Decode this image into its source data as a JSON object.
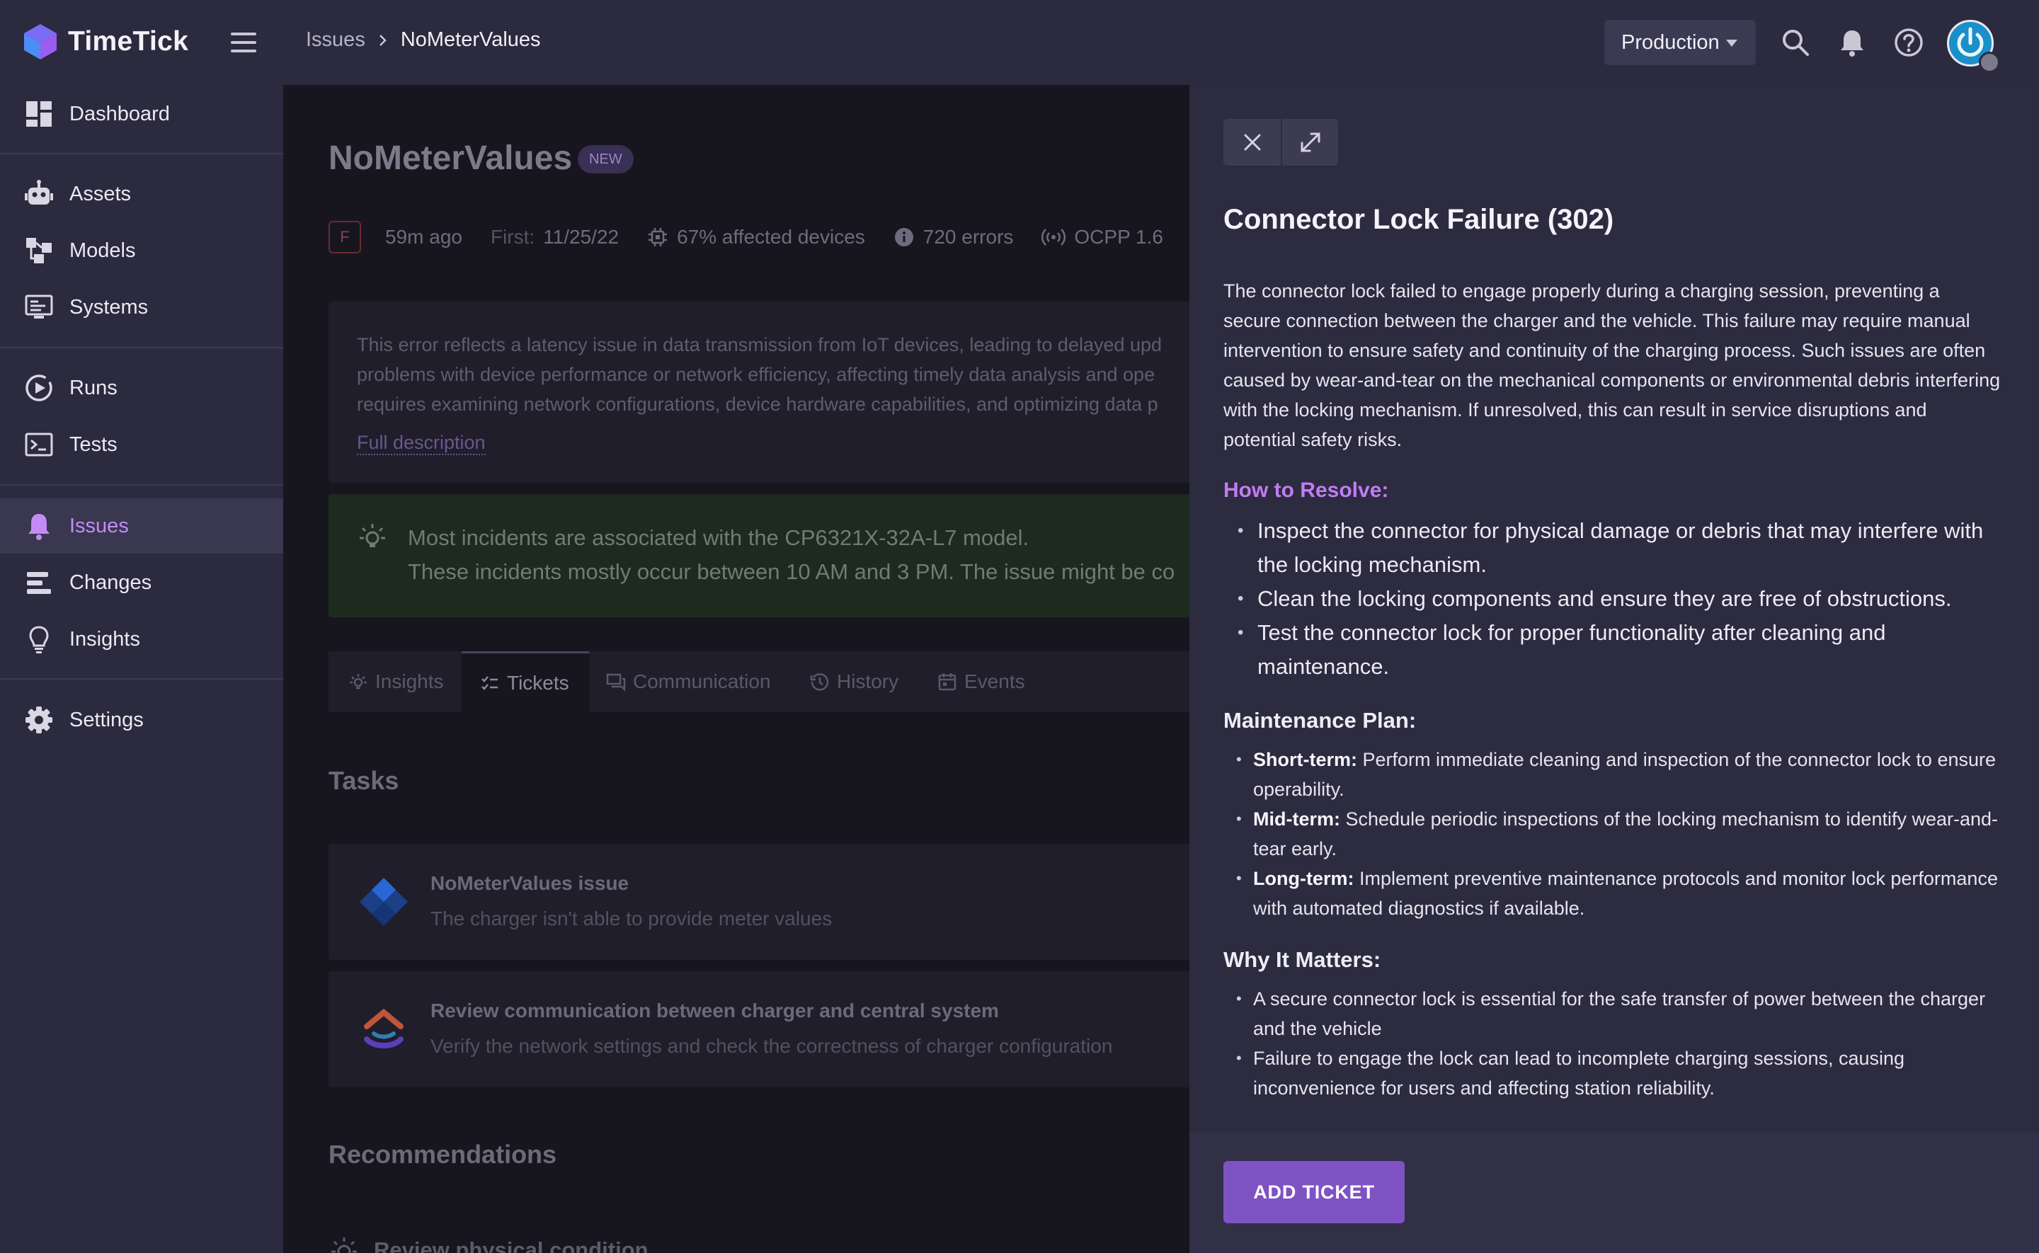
{
  "app": {
    "name": "TimeTick"
  },
  "breadcrumb": {
    "parent": "Issues",
    "current": "NoMeterValues"
  },
  "header": {
    "environment": "Production"
  },
  "sidebar": {
    "items": [
      {
        "label": "Dashboard",
        "icon": "dashboard-icon"
      },
      {
        "label": "Assets",
        "icon": "robot-icon"
      },
      {
        "label": "Models",
        "icon": "models-icon"
      },
      {
        "label": "Systems",
        "icon": "systems-icon"
      },
      {
        "label": "Runs",
        "icon": "play-circle-icon"
      },
      {
        "label": "Tests",
        "icon": "terminal-icon"
      },
      {
        "label": "Issues",
        "icon": "bell-icon",
        "active": true
      },
      {
        "label": "Changes",
        "icon": "changes-icon"
      },
      {
        "label": "Insights",
        "icon": "lightbulb-icon"
      },
      {
        "label": "Settings",
        "icon": "gear-icon"
      }
    ]
  },
  "issue": {
    "title": "NoMeterValues",
    "badge": "NEW",
    "severity": "F",
    "last_seen": "59m ago",
    "first_label": "First:",
    "first_date": "11/25/22",
    "affected": "67% affected devices",
    "errors": "720 errors",
    "protocol": "OCPP 1.6",
    "description_lines": [
      "This error reflects a latency issue in data transmission from IoT devices, leading to delayed upd",
      "problems with device performance or network efficiency, affecting timely data analysis and ope",
      "requires examining network configurations, device hardware capabilities, and optimizing data p"
    ],
    "full_description_link": "Full description",
    "insight_lines": [
      "Most incidents are associated with the CP6321X-32A-L7 model.",
      "These incidents mostly occur between 10 AM and 3 PM. The issue might be co"
    ]
  },
  "tabs": [
    {
      "label": "Insights",
      "icon": "insights-tab-icon"
    },
    {
      "label": "Tickets",
      "icon": "tickets-tab-icon",
      "active": true
    },
    {
      "label": "Communication",
      "icon": "communication-tab-icon"
    },
    {
      "label": "History",
      "icon": "history-tab-icon"
    },
    {
      "label": "Events",
      "icon": "events-tab-icon"
    }
  ],
  "tasks": {
    "title": "Tasks",
    "items": [
      {
        "title": "NoMeterValues issue",
        "subtitle": "The charger isn't able to provide meter values",
        "icon": "jira-icon"
      },
      {
        "title": "Review communication between charger and central system",
        "subtitle": "Verify the network settings and check the correctness of charger configuration",
        "icon": "clickup-icon"
      }
    ]
  },
  "recommendations": {
    "title": "Recommendations",
    "items": [
      {
        "title": "Review physical condition"
      }
    ]
  },
  "drawer": {
    "title": "Connector Lock Failure (302)",
    "description": "The connector lock failed to engage properly during a charging session, preventing a secure connection between the charger and the vehicle. This failure may require manual intervention to ensure safety and continuity of the charging process. Such issues are often caused by wear-and-tear on the mechanical components or environmental debris interfering with the locking mechanism. If unresolved, this can result in service disruptions and potential safety risks.",
    "resolve_heading": "How to Resolve:",
    "resolve_steps": [
      "Inspect the connector for physical damage or debris that may interfere with the locking mechanism.",
      "Clean the locking components and ensure they are free of obstructions.",
      "Test the connector lock for proper functionality after cleaning and maintenance."
    ],
    "plan_heading": "Maintenance Plan:",
    "plan": [
      {
        "term": "Short-term:",
        "text": "Perform immediate cleaning and inspection of the connector lock to ensure operability."
      },
      {
        "term": "Mid-term:",
        "text": "Schedule periodic inspections of the locking mechanism to identify wear-and-tear early."
      },
      {
        "term": "Long-term:",
        "text": "Implement preventive maintenance protocols and monitor lock performance with automated diagnostics if available."
      }
    ],
    "why_heading": "Why It Matters:",
    "why": [
      "A secure connector lock is essential for the safe transfer of power between the charger and the vehicle",
      "Failure to engage the lock can lead to incomplete charging sessions, causing inconvenience for users and affecting station reliability."
    ],
    "add_ticket": "ADD TICKET"
  },
  "colors": {
    "accent": "#c17cf2",
    "button": "#7f52c4",
    "sidebar_bg": "#2b2a3e",
    "drawer_bg": "#2c2b3f"
  }
}
